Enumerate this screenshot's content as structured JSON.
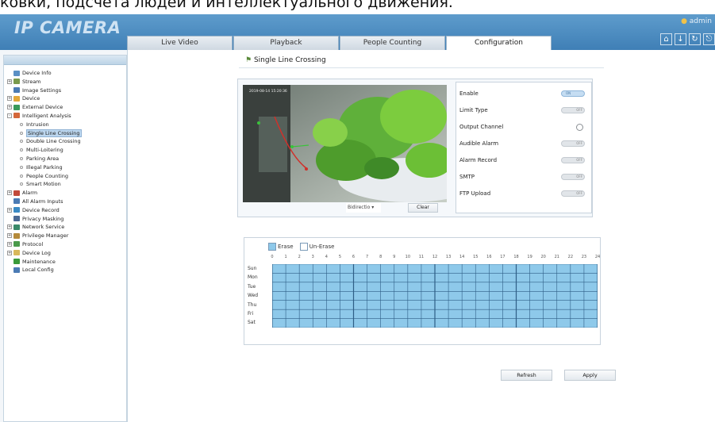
{
  "caption": "ковки, подсчета людей и интеллектуального движения.",
  "app": {
    "logo": "IP CAMERA",
    "user": "admin",
    "tabs": [
      "Live Video",
      "Playback",
      "People Counting",
      "Configuration"
    ],
    "active_tab": 3,
    "top_icons": [
      "home-icon",
      "download-icon",
      "refresh-icon",
      "exit-icon"
    ]
  },
  "sidebar": {
    "items": [
      {
        "label": "Device Info",
        "level": 0,
        "expander": "",
        "icon": "info-icon",
        "color": "#5a8fc4"
      },
      {
        "label": "Stream",
        "level": 0,
        "expander": "+",
        "icon": "stream-icon",
        "color": "#7a9a4c"
      },
      {
        "label": "Image Settings",
        "level": 0,
        "expander": "",
        "icon": "image-icon",
        "color": "#4b7bb4"
      },
      {
        "label": "Device",
        "level": 0,
        "expander": "+",
        "icon": "device-icon",
        "color": "#e3a83a"
      },
      {
        "label": "External Device",
        "level": 0,
        "expander": "+",
        "icon": "external-device-icon",
        "color": "#3a9a5a"
      },
      {
        "label": "Intelligent Analysis",
        "level": 0,
        "expander": "-",
        "icon": "intelligent-icon",
        "color": "#d4673a"
      },
      {
        "label": "Intrusion",
        "level": 1
      },
      {
        "label": "Single Line Crossing",
        "level": 1,
        "selected": true
      },
      {
        "label": "Double Line Crossing",
        "level": 1
      },
      {
        "label": "Multi-Loitering",
        "level": 1
      },
      {
        "label": "Parking Area",
        "level": 1
      },
      {
        "label": "Illegal Parking",
        "level": 1
      },
      {
        "label": "People Counting",
        "level": 1
      },
      {
        "label": "Smart Motion",
        "level": 1
      },
      {
        "label": "Alarm",
        "level": 0,
        "expander": "+",
        "icon": "alarm-icon",
        "color": "#c24a3a"
      },
      {
        "label": "All Alarm Inputs",
        "level": 0,
        "expander": "",
        "icon": "alarm-input-icon",
        "color": "#4b7bb4"
      },
      {
        "label": "Device Record",
        "level": 0,
        "expander": "+",
        "icon": "record-icon",
        "color": "#3a8ac4"
      },
      {
        "label": "Privacy Masking",
        "level": 0,
        "expander": "",
        "icon": "privacy-icon",
        "color": "#4b6a94"
      },
      {
        "label": "Network Service",
        "level": 0,
        "expander": "+",
        "icon": "network-icon",
        "color": "#3a8a6a"
      },
      {
        "label": "Privilege Manager",
        "level": 0,
        "expander": "+",
        "icon": "privilege-icon",
        "color": "#b48a3a"
      },
      {
        "label": "Protocol",
        "level": 0,
        "expander": "+",
        "icon": "protocol-icon",
        "color": "#4a9a4a"
      },
      {
        "label": "Device Log",
        "level": 0,
        "expander": "+",
        "icon": "log-icon",
        "color": "#d8b85a"
      },
      {
        "label": "Maintenance",
        "level": 0,
        "expander": "",
        "icon": "maintenance-icon",
        "color": "#3a9a3a"
      },
      {
        "label": "Local Config",
        "level": 0,
        "expander": "",
        "icon": "local-config-icon",
        "color": "#4b7bb4"
      }
    ]
  },
  "main": {
    "title": "Single Line Crossing",
    "video": {
      "timestamp": "2019-08-14 15:20:36"
    },
    "settings": [
      {
        "label": "Enable",
        "control": "toggle",
        "state": "ON"
      },
      {
        "label": "Limit Type",
        "control": "toggle",
        "state": "OFF"
      },
      {
        "label": "Output Channel",
        "control": "radio",
        "state": ""
      },
      {
        "label": "Audible Alarm",
        "control": "toggle",
        "state": "OFF"
      },
      {
        "label": "Alarm Record",
        "control": "toggle",
        "state": "OFF"
      },
      {
        "label": "SMTP",
        "control": "toggle",
        "state": "OFF"
      },
      {
        "label": "FTP Upload",
        "control": "toggle",
        "state": "OFF"
      }
    ],
    "direction_select": "Bidirectio",
    "clear_label": "Clear",
    "schedule": {
      "erase_label": "Erase",
      "unerase_label": "Un-Erase",
      "hours": [
        "0",
        "1",
        "2",
        "3",
        "4",
        "5",
        "6",
        "7",
        "8",
        "9",
        "10",
        "11",
        "12",
        "13",
        "14",
        "15",
        "16",
        "17",
        "18",
        "19",
        "20",
        "21",
        "22",
        "23",
        "24"
      ],
      "days": [
        "Sun",
        "Mon",
        "Tue",
        "Wed",
        "Thu",
        "Fri",
        "Sat"
      ],
      "fill_color": "#8ec9ea",
      "line_color": "#2f5e86"
    },
    "refresh_label": "Refresh",
    "apply_label": "Apply"
  }
}
